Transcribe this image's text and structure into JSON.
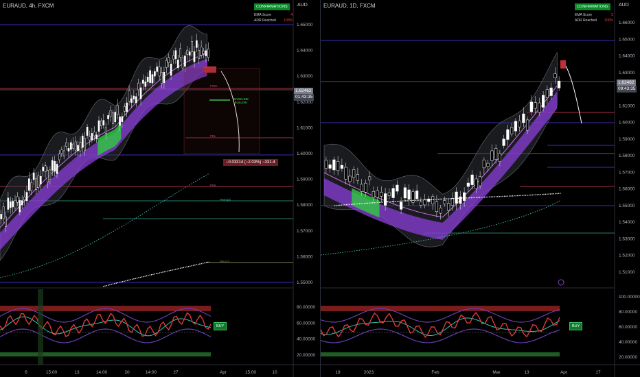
{
  "left_chart": {
    "title": "EURAUD, 4h, FXCM",
    "currency": "AUD",
    "price_axis": [
      "1.65000",
      "1.64000",
      "1.63000",
      "1.62000",
      "1.61000",
      "1.60000",
      "1.59000",
      "1.58000",
      "1.57000",
      "1.56000",
      "1.55000"
    ],
    "osc_axis": [
      "80.00000",
      "60.00000",
      "40.00000",
      "20.00000"
    ],
    "time_axis": [
      "6",
      "15:00",
      "13",
      "14:00",
      "20",
      "14:00",
      "27",
      "Apr",
      "15:00",
      "10"
    ],
    "last_price": "1.62462",
    "countdown": "01:43:35",
    "confirmations": {
      "title": "CONFIRMATIONS",
      "rows": [
        {
          "label": "EMA Score",
          "value": "4"
        },
        {
          "label": "ADR Reached",
          "value": "100%"
        }
      ]
    },
    "measure": "−0.03314 (−2.03%) −331.4",
    "baseline": "BASELINE\nBULLISH",
    "buy_label": "BUY",
    "level_labels": [
      "PWH",
      "PDL",
      "PWL",
      "PMHigh",
      "Pivot S"
    ]
  },
  "right_chart": {
    "title": "EURAUD, 1D, FXCM",
    "currency": "AUD",
    "price_axis": [
      "1.66000",
      "1.65000",
      "1.64000",
      "1.63000",
      "1.62000",
      "1.61000",
      "1.60000",
      "1.59000",
      "1.58000",
      "1.57000",
      "1.56000",
      "1.55000",
      "1.54000",
      "1.53000",
      "1.52000",
      "1.51000"
    ],
    "osc_axis": [
      "100.00000",
      "80.00000",
      "60.00000",
      "40.00000",
      "20.00000"
    ],
    "time_axis": [
      "19",
      "2023",
      "Feb",
      "Mar",
      "13",
      "Apr",
      "17"
    ],
    "last_price": "1.62462",
    "countdown": "09:43:35",
    "confirmations": {
      "title": "CONFIRMATIONS",
      "rows": [
        {
          "label": "EMA Score",
          "value": "5"
        },
        {
          "label": "ADR Reached",
          "value": "100%"
        }
      ]
    },
    "buy_label": "BUY"
  },
  "colors": {
    "background": "#000000",
    "bull": "#ffffff",
    "bear": "#ffffff",
    "cloud": "#8b3fd9",
    "green_cloud": "#2ecc40",
    "level_purple": "#3b2dbd",
    "level_red": "#a8324a",
    "level_teal": "#2a7d6e",
    "overbought": "#7a1c1c",
    "oversold": "#1f5e22"
  }
}
